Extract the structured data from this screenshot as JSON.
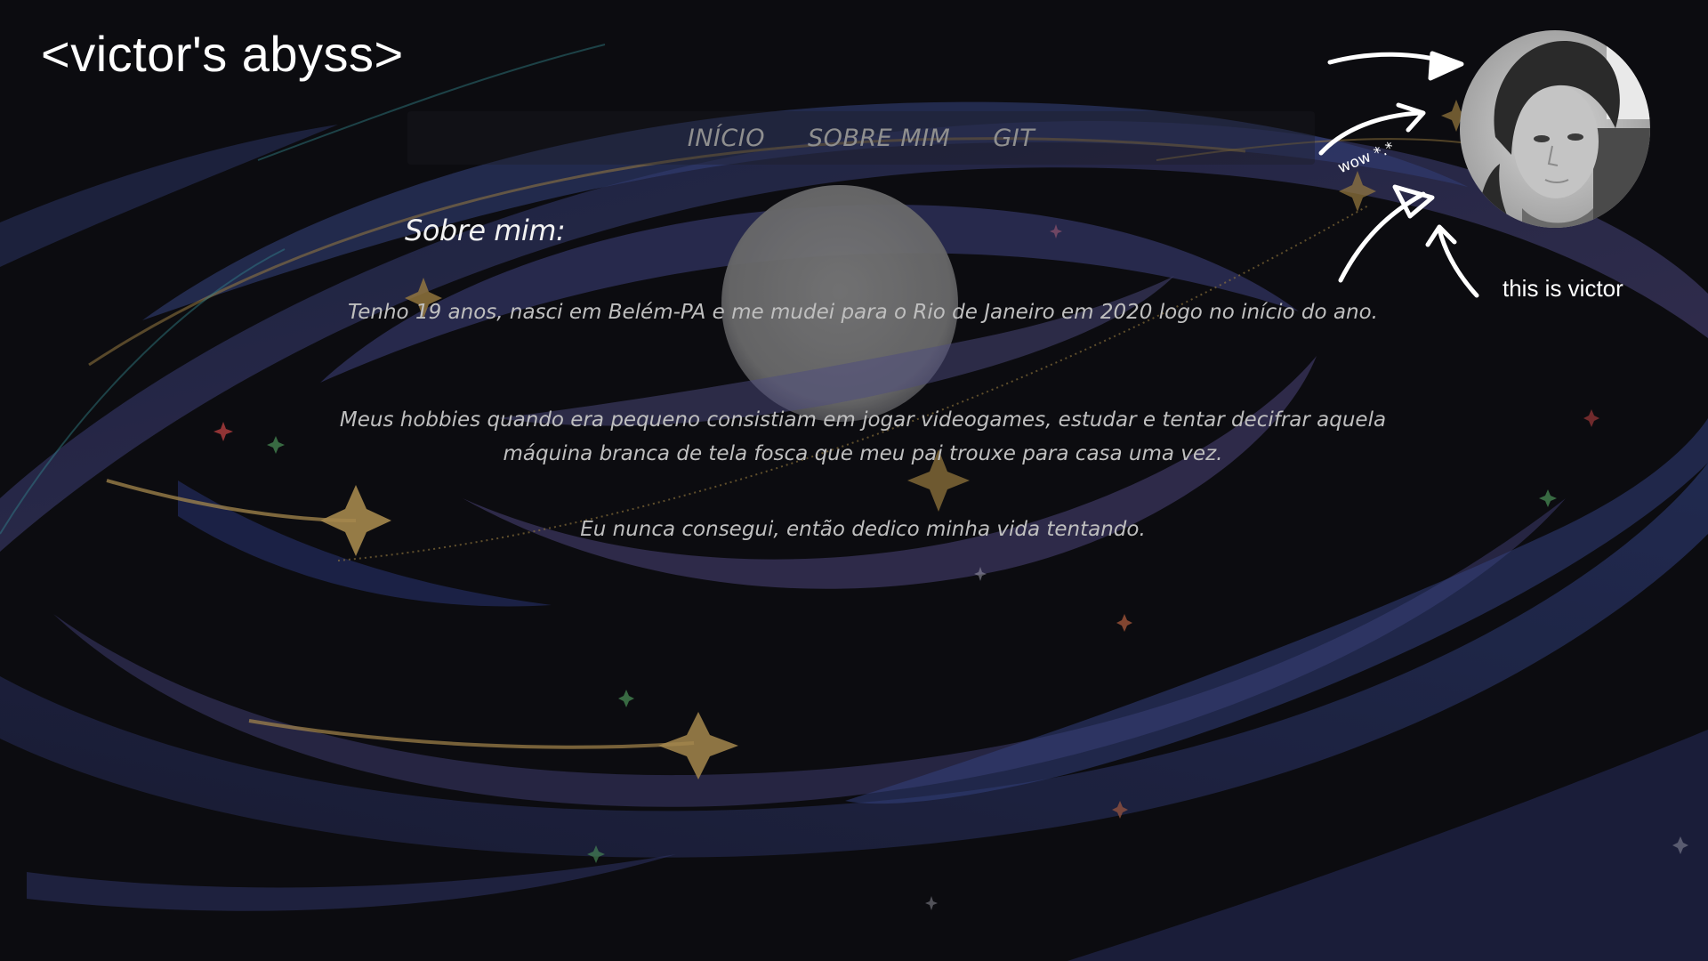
{
  "site": {
    "title": "<victor's abyss>"
  },
  "nav": {
    "items": [
      {
        "label": "INÍCIO"
      },
      {
        "label": "SOBRE MIM"
      },
      {
        "label": "GIT"
      }
    ]
  },
  "about": {
    "heading": "Sobre mim:",
    "paragraphs": [
      "Tenho 19 anos, nasci em Belém-PA e me mudei para o Rio de Janeiro em 2020 logo no início do ano.",
      "Meus hobbies quando era pequeno consistiam em jogar videogames, estudar e tentar decifrar aquela máquina branca de tela fosca que meu pai trouxe para casa uma vez.",
      "Eu nunca consegui, então dedico minha vida tentando."
    ]
  },
  "profile": {
    "caption": "this is victor",
    "exclaim": "wow *.*"
  },
  "colors": {
    "background": "#0d0d10",
    "swirl_blue": "#3b4a8c",
    "swirl_purple": "#5c4a8a",
    "gold": "#b8944a",
    "moon": "#8a8a8a",
    "nav_text": "#8f8f8f"
  }
}
